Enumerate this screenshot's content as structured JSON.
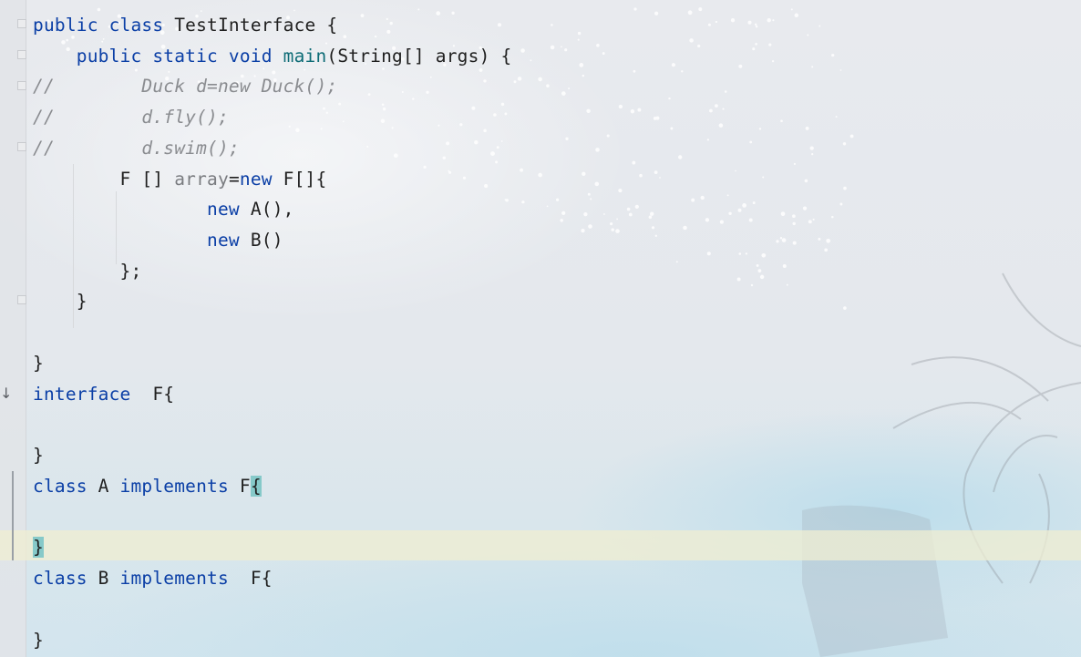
{
  "editor": {
    "lines": [
      {
        "tokens": [
          {
            "t": "kw",
            "v": "public class "
          },
          {
            "t": "",
            "v": "TestInterface {"
          }
        ]
      },
      {
        "tokens": [
          {
            "t": "",
            "v": "    "
          },
          {
            "t": "kw",
            "v": "public static void "
          },
          {
            "t": "fn",
            "v": "main"
          },
          {
            "t": "",
            "v": "(String[] args) {"
          }
        ]
      },
      {
        "tokens": [
          {
            "t": "cm",
            "v": "//        Duck d=new Duck();"
          }
        ]
      },
      {
        "tokens": [
          {
            "t": "cm",
            "v": "//        d.fly();"
          }
        ]
      },
      {
        "tokens": [
          {
            "t": "cm",
            "v": "//        d.swim();"
          }
        ]
      },
      {
        "tokens": [
          {
            "t": "",
            "v": "        F [] "
          },
          {
            "t": "var",
            "v": "array"
          },
          {
            "t": "",
            "v": "="
          },
          {
            "t": "kw",
            "v": "new "
          },
          {
            "t": "",
            "v": "F[]{"
          }
        ]
      },
      {
        "tokens": [
          {
            "t": "",
            "v": "                "
          },
          {
            "t": "kw",
            "v": "new "
          },
          {
            "t": "",
            "v": "A(),"
          }
        ]
      },
      {
        "tokens": [
          {
            "t": "",
            "v": "                "
          },
          {
            "t": "kw",
            "v": "new "
          },
          {
            "t": "",
            "v": "B()"
          }
        ]
      },
      {
        "tokens": [
          {
            "t": "",
            "v": "        };"
          }
        ]
      },
      {
        "tokens": [
          {
            "t": "",
            "v": "    }"
          }
        ]
      },
      {
        "tokens": []
      },
      {
        "tokens": [
          {
            "t": "",
            "v": "}"
          }
        ]
      },
      {
        "tokens": [
          {
            "t": "kw",
            "v": "interface "
          },
          {
            "t": "",
            "v": " F{"
          }
        ]
      },
      {
        "tokens": []
      },
      {
        "tokens": [
          {
            "t": "",
            "v": "}"
          }
        ]
      },
      {
        "tokens": [
          {
            "t": "kw",
            "v": "class "
          },
          {
            "t": "",
            "v": "A "
          },
          {
            "t": "kw",
            "v": "implements "
          },
          {
            "t": "",
            "v": "F"
          },
          {
            "t": "hl",
            "v": "{"
          }
        ]
      },
      {
        "tokens": []
      },
      {
        "tokens": [
          {
            "t": "hl",
            "v": "}"
          }
        ]
      },
      {
        "tokens": [
          {
            "t": "kw",
            "v": "class "
          },
          {
            "t": "",
            "v": "B "
          },
          {
            "t": "kw",
            "v": "implements "
          },
          {
            "t": "",
            "v": " F{"
          }
        ]
      },
      {
        "tokens": []
      },
      {
        "tokens": [
          {
            "t": "",
            "v": "}"
          }
        ]
      }
    ]
  },
  "gutter": {
    "implemented_marker_icon": "down-arrow-icon",
    "marker_glyph": "↓"
  },
  "colors": {
    "keyword": "#0b3fa6",
    "comment": "#8a8c90",
    "method": "#0e6c76",
    "brace_highlight": "#86c9c9",
    "caret_line": "#f0eed2"
  }
}
